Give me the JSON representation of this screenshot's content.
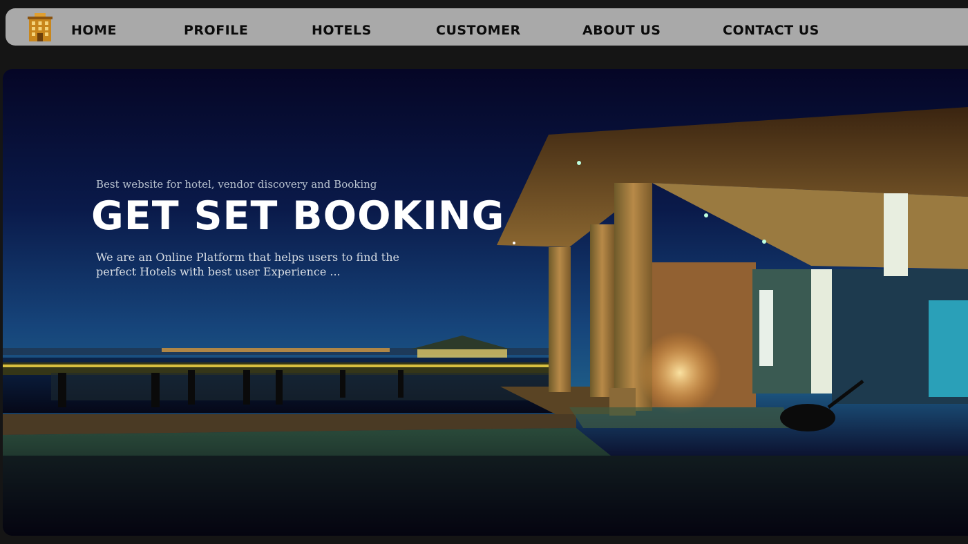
{
  "nav": {
    "logo_icon": "hotel-building-icon",
    "items": [
      {
        "label": "HOME"
      },
      {
        "label": "PROFILE"
      },
      {
        "label": "HOTELS"
      },
      {
        "label": "CUSTOMER"
      },
      {
        "label": "ABOUT US"
      },
      {
        "label": "CONTACT US"
      }
    ]
  },
  "hero": {
    "tagline": "Best website for hotel, vendor discovery and Booking",
    "headline": "GET SET BOOKING",
    "description": "We are an Online Platform that helps users to find the perfect Hotels with best user Experience ...",
    "background_image": "night-resort-pavilion-by-water"
  },
  "colors": {
    "page_background": "#151515",
    "navbar_background": "#a9a9a9",
    "nav_text": "#0b0b0b",
    "headline": "#ffffff"
  }
}
